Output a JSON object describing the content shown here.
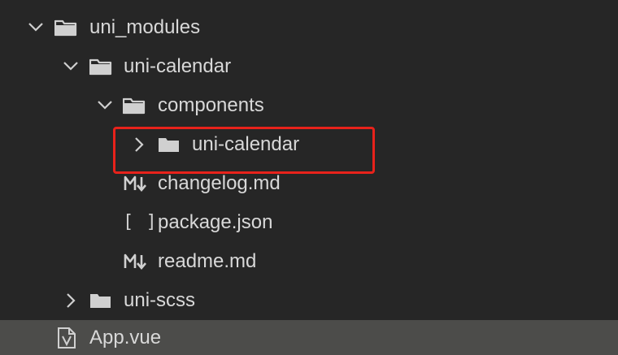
{
  "tree": {
    "items": [
      {
        "label": "uni_modules",
        "kind": "folder",
        "state": "expanded",
        "icon": "folder-open-icon"
      },
      {
        "label": "uni-calendar",
        "kind": "folder",
        "state": "expanded",
        "icon": "folder-open-icon"
      },
      {
        "label": "components",
        "kind": "folder",
        "state": "expanded",
        "icon": "folder-open-icon"
      },
      {
        "label": "uni-calendar",
        "kind": "folder",
        "state": "collapsed",
        "icon": "folder-icon",
        "highlighted": true
      },
      {
        "label": "changelog.md",
        "kind": "file",
        "icon": "markdown-icon"
      },
      {
        "label": "package.json",
        "kind": "file",
        "icon": "json-icon"
      },
      {
        "label": "readme.md",
        "kind": "file",
        "icon": "markdown-icon"
      },
      {
        "label": "uni-scss",
        "kind": "folder",
        "state": "collapsed",
        "icon": "folder-icon"
      },
      {
        "label": "App.vue",
        "kind": "file",
        "icon": "vue-file-icon",
        "selected": true
      }
    ],
    "icon_glyphs": {
      "json": "[ ]"
    }
  },
  "colors": {
    "background": "#262626",
    "selected_row": "#4c4c4a",
    "text": "#d8d8d8",
    "icon": "#d0d0d0",
    "highlight_border": "#e8221b"
  }
}
